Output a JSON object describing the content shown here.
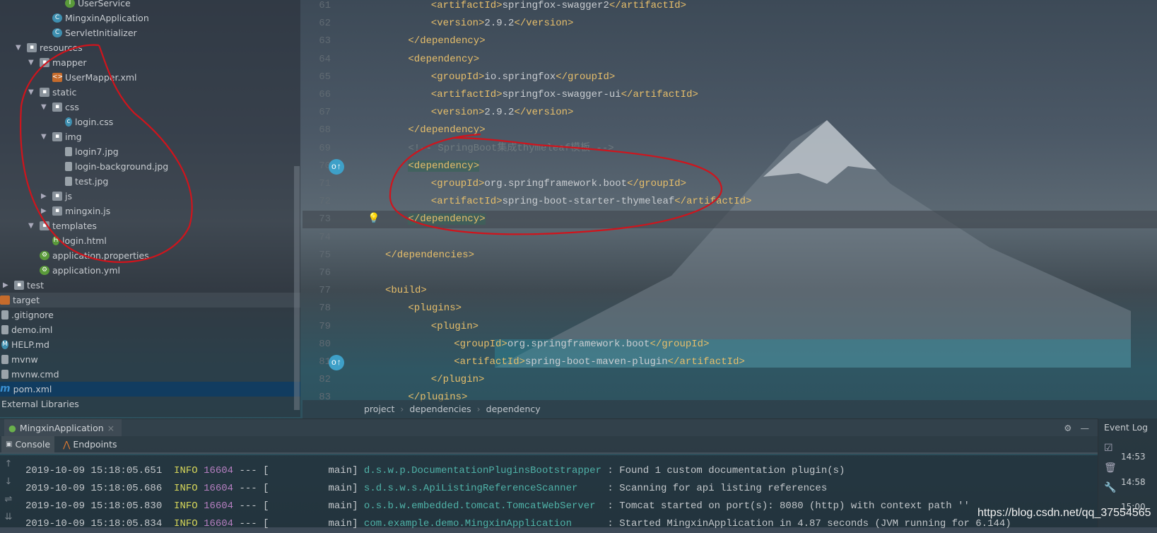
{
  "project_tree": [
    {
      "label": "UserService",
      "icon": "interface-icon",
      "depth": 4
    },
    {
      "label": "MingxinApplication",
      "icon": "spring-class-icon",
      "depth": 3
    },
    {
      "label": "ServletInitializer",
      "icon": "class-icon",
      "depth": 3
    },
    {
      "label": "resources",
      "icon": "folder-icon",
      "depth": 1,
      "expanded": true
    },
    {
      "label": "mapper",
      "icon": "folder-icon",
      "depth": 2,
      "expanded": true
    },
    {
      "label": "UserMapper.xml",
      "icon": "xml-file-icon",
      "depth": 3
    },
    {
      "label": "static",
      "icon": "folder-icon",
      "depth": 2,
      "expanded": true
    },
    {
      "label": "css",
      "icon": "folder-icon",
      "depth": 3,
      "expanded": true
    },
    {
      "label": "login.css",
      "icon": "css-file-icon",
      "depth": 4
    },
    {
      "label": "img",
      "icon": "folder-icon",
      "depth": 3,
      "expanded": true
    },
    {
      "label": "login7.jpg",
      "icon": "image-file-icon",
      "depth": 4
    },
    {
      "label": "login-background.jpg",
      "icon": "image-file-icon",
      "depth": 4
    },
    {
      "label": "test.jpg",
      "icon": "image-file-icon",
      "depth": 4
    },
    {
      "label": "js",
      "icon": "folder-icon",
      "depth": 3,
      "expanded": false
    },
    {
      "label": "mingxin.js",
      "icon": "folder-icon",
      "depth": 3,
      "expanded": false
    },
    {
      "label": "templates",
      "icon": "folder-icon",
      "depth": 2,
      "expanded": true
    },
    {
      "label": "login.html",
      "icon": "html-file-icon",
      "depth": 3
    },
    {
      "label": "application.properties",
      "icon": "spring-config-icon",
      "depth": 2
    },
    {
      "label": "application.yml",
      "icon": "spring-config-icon",
      "depth": 2
    },
    {
      "label": "test",
      "icon": "folder-icon",
      "depth": 0,
      "expanded": false
    },
    {
      "label": "target",
      "icon": "excluded-folder-icon",
      "depth": -1,
      "highlight": true
    },
    {
      "label": ".gitignore",
      "icon": "text-file-icon",
      "depth": -1
    },
    {
      "label": "demo.iml",
      "icon": "iml-file-icon",
      "depth": -1
    },
    {
      "label": "HELP.md",
      "icon": "markdown-file-icon",
      "depth": -1
    },
    {
      "label": "mvnw",
      "icon": "text-file-icon",
      "depth": -1
    },
    {
      "label": "mvnw.cmd",
      "icon": "text-file-icon",
      "depth": -1
    },
    {
      "label": "pom.xml",
      "icon": "maven-icon",
      "depth": -1,
      "selected": true
    },
    {
      "label": "External Libraries",
      "icon": "",
      "depth": -1
    }
  ],
  "editor": {
    "current_line": 73,
    "lines": [
      {
        "n": "61",
        "indent": 3,
        "parts": [
          [
            "tag",
            "<artifactId>"
          ],
          [
            "txt",
            "springfox-swagger2"
          ],
          [
            "tag",
            "</artifactId>"
          ]
        ]
      },
      {
        "n": "62",
        "indent": 3,
        "parts": [
          [
            "tag",
            "<version>"
          ],
          [
            "txt",
            "2.9.2"
          ],
          [
            "tag",
            "</version>"
          ]
        ]
      },
      {
        "n": "63",
        "indent": 2,
        "parts": [
          [
            "tag",
            "</dependency>"
          ]
        ]
      },
      {
        "n": "64",
        "indent": 2,
        "parts": [
          [
            "tag",
            "<dependency>"
          ]
        ]
      },
      {
        "n": "65",
        "indent": 3,
        "parts": [
          [
            "tag",
            "<groupId>"
          ],
          [
            "txt",
            "io.springfox"
          ],
          [
            "tag",
            "</groupId>"
          ]
        ]
      },
      {
        "n": "66",
        "indent": 3,
        "parts": [
          [
            "tag",
            "<artifactId>"
          ],
          [
            "txt",
            "springfox-swagger-ui"
          ],
          [
            "tag",
            "</artifactId>"
          ]
        ]
      },
      {
        "n": "67",
        "indent": 3,
        "parts": [
          [
            "tag",
            "<version>"
          ],
          [
            "txt",
            "2.9.2"
          ],
          [
            "tag",
            "</version>"
          ]
        ]
      },
      {
        "n": "68",
        "indent": 2,
        "parts": [
          [
            "tag",
            "</dependency>"
          ]
        ]
      },
      {
        "n": "69",
        "indent": 2,
        "parts": [
          [
            "cmt",
            "<!-- SpringBoot集成thymeleaf模板 -->"
          ]
        ]
      },
      {
        "n": "70",
        "indent": 2,
        "parts": [
          [
            "tag tagbg",
            "<dependency>"
          ]
        ],
        "icon": "override-icon"
      },
      {
        "n": "71",
        "indent": 3,
        "parts": [
          [
            "tag",
            "<groupId>"
          ],
          [
            "txt",
            "org.springframework.boot"
          ],
          [
            "tag",
            "</groupId>"
          ]
        ]
      },
      {
        "n": "72",
        "indent": 3,
        "parts": [
          [
            "tag",
            "<artifactId>"
          ],
          [
            "txt",
            "spring-boot-starter-thymeleaf"
          ],
          [
            "tag",
            "</artifactId>"
          ]
        ]
      },
      {
        "n": "73",
        "indent": 2,
        "parts": [
          [
            "tag tagbg",
            "</dependency>"
          ]
        ],
        "icon": "lightbulb-icon"
      },
      {
        "n": "74",
        "indent": 0,
        "parts": []
      },
      {
        "n": "75",
        "indent": 1,
        "parts": [
          [
            "tag",
            "</dependencies>"
          ]
        ]
      },
      {
        "n": "76",
        "indent": 0,
        "parts": []
      },
      {
        "n": "77",
        "indent": 1,
        "parts": [
          [
            "tag",
            "<build>"
          ]
        ]
      },
      {
        "n": "78",
        "indent": 2,
        "parts": [
          [
            "tag",
            "<plugins>"
          ]
        ]
      },
      {
        "n": "79",
        "indent": 3,
        "parts": [
          [
            "tag",
            "<plugin>"
          ]
        ]
      },
      {
        "n": "80",
        "indent": 4,
        "parts": [
          [
            "tag",
            "<groupId>"
          ],
          [
            "txt",
            "org.springframework.boot"
          ],
          [
            "tag",
            "</groupId>"
          ]
        ]
      },
      {
        "n": "81",
        "indent": 4,
        "parts": [
          [
            "tag",
            "<artifactId>"
          ],
          [
            "txt",
            "spring-boot-maven-plugin"
          ],
          [
            "tag",
            "</artifactId>"
          ]
        ],
        "icon": "override-icon"
      },
      {
        "n": "82",
        "indent": 3,
        "parts": [
          [
            "tag",
            "</plugin>"
          ]
        ]
      },
      {
        "n": "83",
        "indent": 2,
        "parts": [
          [
            "tag",
            "</plugins>"
          ]
        ]
      }
    ]
  },
  "breadcrumb": [
    "project",
    "dependencies",
    "dependency"
  ],
  "run": {
    "tab_label": "MingxinApplication",
    "close": "×",
    "subtabs": [
      "Console",
      "Endpoints"
    ]
  },
  "console": [
    {
      "ts": "2019-10-09 15:18:05.651",
      "level": "INFO",
      "pid": "16604",
      "sep": "--- [",
      "thread": "main]",
      "logger": "d.s.w.p.DocumentationPluginsBootstrapper",
      "msg": ": Found 1 custom documentation plugin(s)"
    },
    {
      "ts": "2019-10-09 15:18:05.686",
      "level": "INFO",
      "pid": "16604",
      "sep": "--- [",
      "thread": "main]",
      "logger": "s.d.s.w.s.ApiListingReferenceScanner",
      "msg": ": Scanning for api listing references"
    },
    {
      "ts": "2019-10-09 15:18:05.830",
      "level": "INFO",
      "pid": "16604",
      "sep": "--- [",
      "thread": "main]",
      "logger": "o.s.b.w.embedded.tomcat.TomcatWebServer",
      "msg": ": Tomcat started on port(s): 8080 (http) with context path ''"
    },
    {
      "ts": "2019-10-09 15:18:05.834",
      "level": "INFO",
      "pid": "16604",
      "sep": "--- [",
      "thread": "main]",
      "logger": "com.example.demo.MingxinApplication",
      "msg": ": Started MingxinApplication in 4.87 seconds (JVM running for 6.144)"
    }
  ],
  "event_log": {
    "title": "Event Log",
    "times": [
      "14:53",
      "14:58",
      "15:00"
    ]
  },
  "watermark": "https://blog.csdn.net/qq_37554565",
  "colors": {
    "tag": "#e8bf6a",
    "info": "#d7d75a",
    "pid": "#b57fc0",
    "logger": "#4fb2a8",
    "annotation": "#d0141c",
    "selection": "#0d3c64"
  }
}
